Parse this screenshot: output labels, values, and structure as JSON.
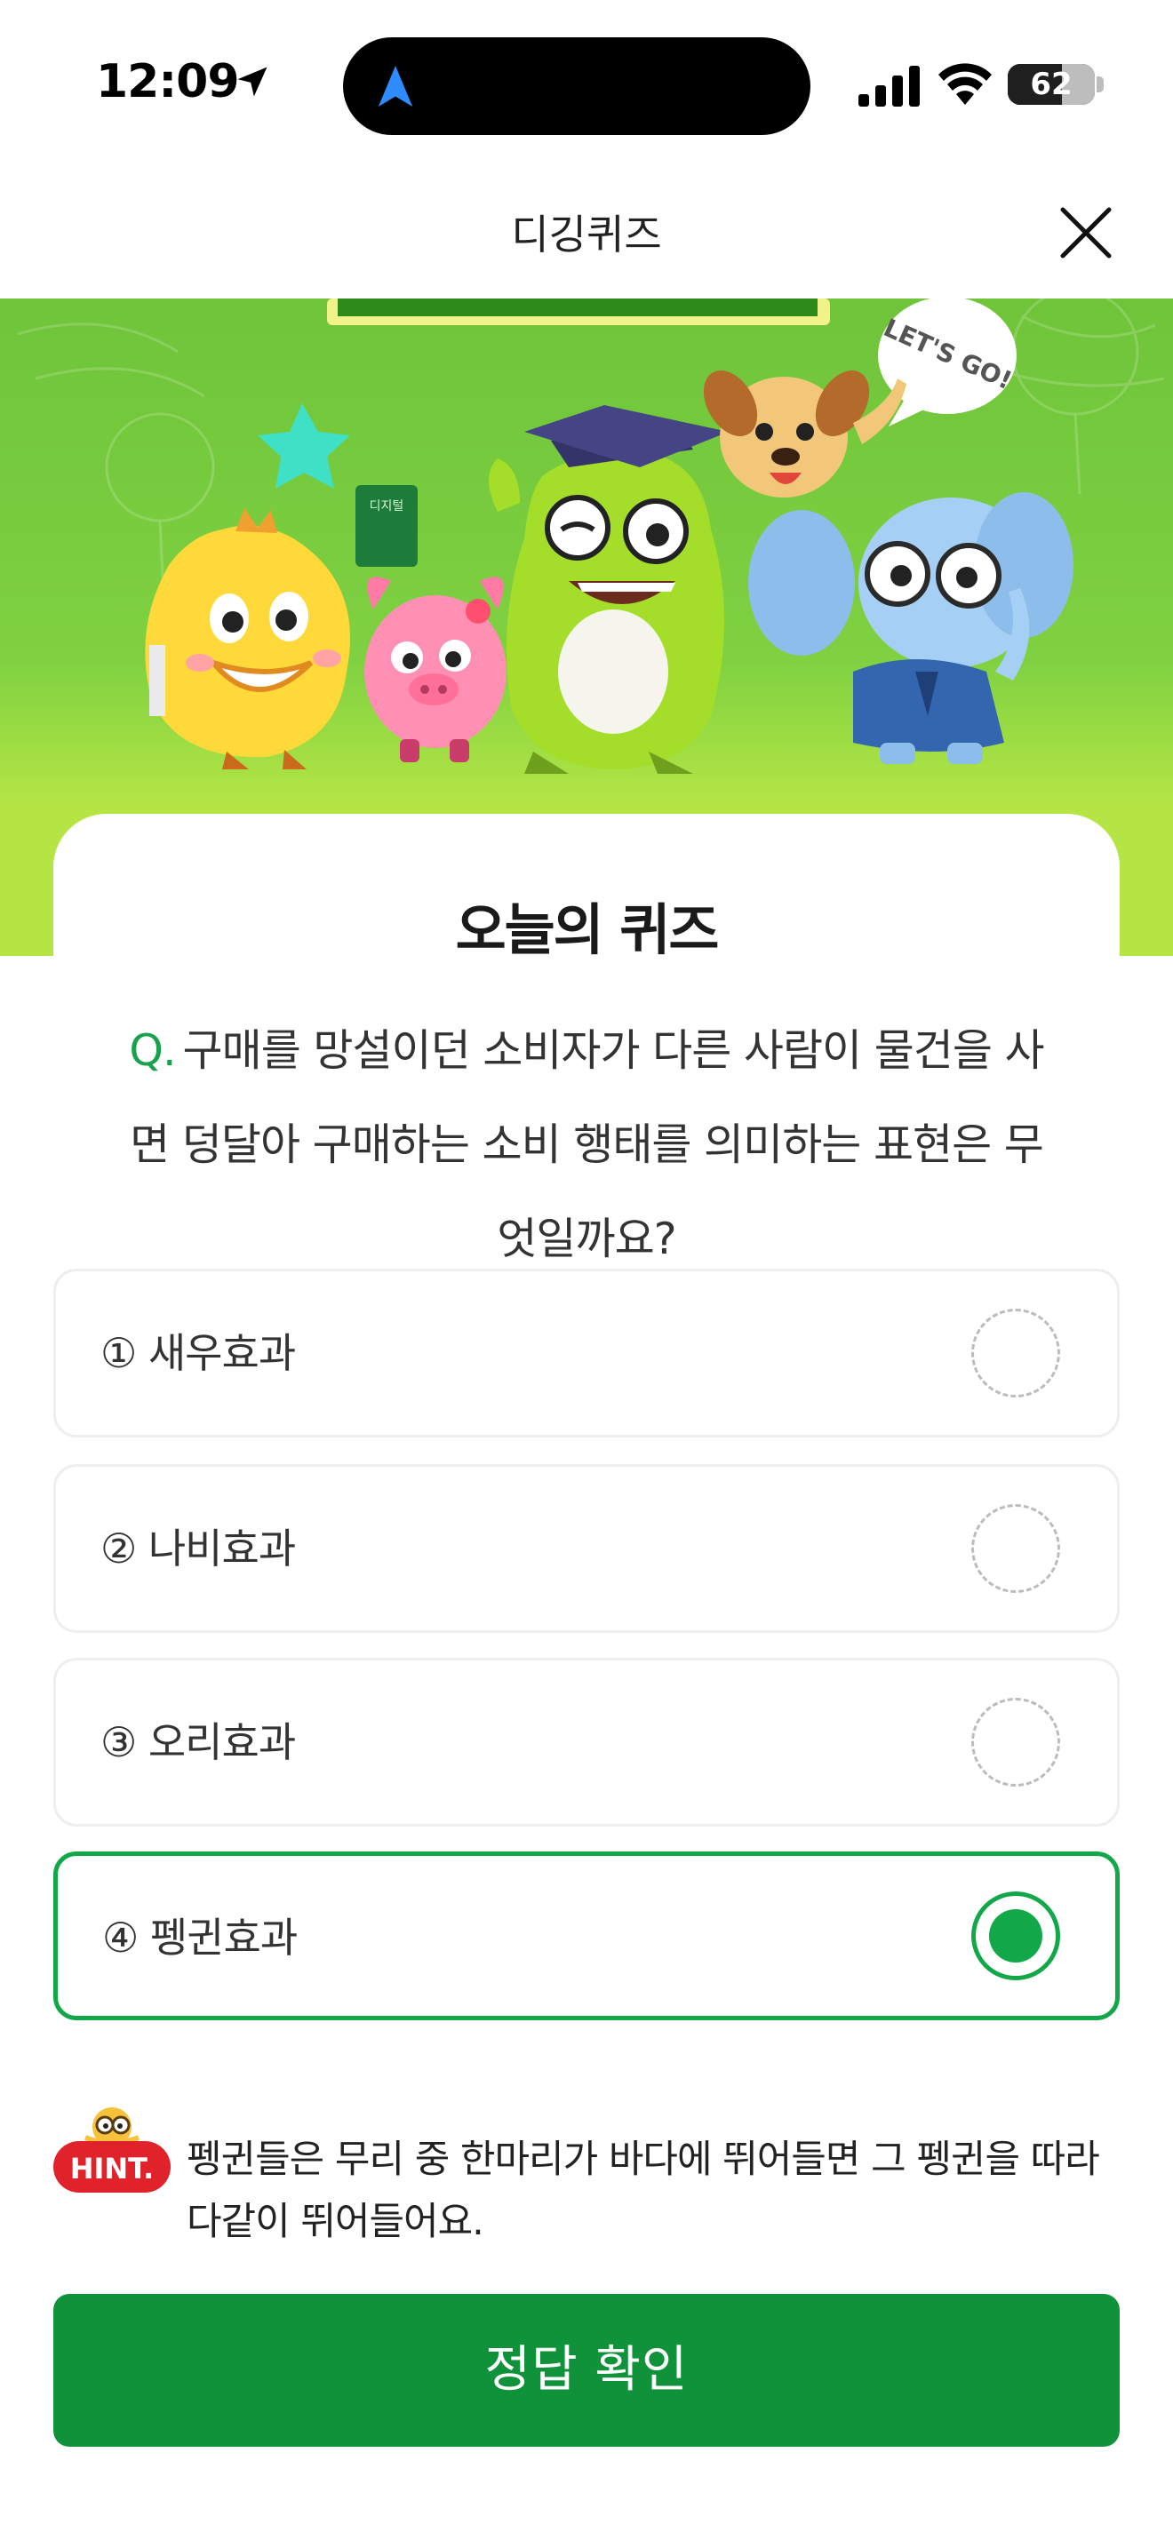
{
  "status_bar": {
    "time": "12:09",
    "battery_level": "62",
    "battery_fraction": 0.62
  },
  "header": {
    "title": "디깅퀴즈",
    "close_icon": "close-icon"
  },
  "banner": {
    "speech_bubble": "LET'S GO!",
    "book_label": "디지털"
  },
  "quiz": {
    "section_title": "오늘의 퀴즈",
    "question_prefix": "Q.",
    "question_text": "구매를 망설이던 소비자가 다른 사람이 물건을 사면 덩달아 구매하는 소비 행태를 의미하는 표현은 무엇일까요?",
    "options": [
      {
        "label": "① 새우효과",
        "selected": false
      },
      {
        "label": "② 나비효과",
        "selected": false
      },
      {
        "label": "③ 오리효과",
        "selected": false
      },
      {
        "label": "④ 펭귄효과",
        "selected": true
      }
    ]
  },
  "hint": {
    "badge": "HINT.",
    "text": "펭귄들은 무리 중 한마리가 바다에 뛰어들면 그 펭귄을 따라 다같이 뛰어들어요."
  },
  "confirm_button": {
    "label": "정답 확인"
  },
  "colors": {
    "accent": "#12a849",
    "button": "#0f9239",
    "banner_green": "#7fd141"
  }
}
